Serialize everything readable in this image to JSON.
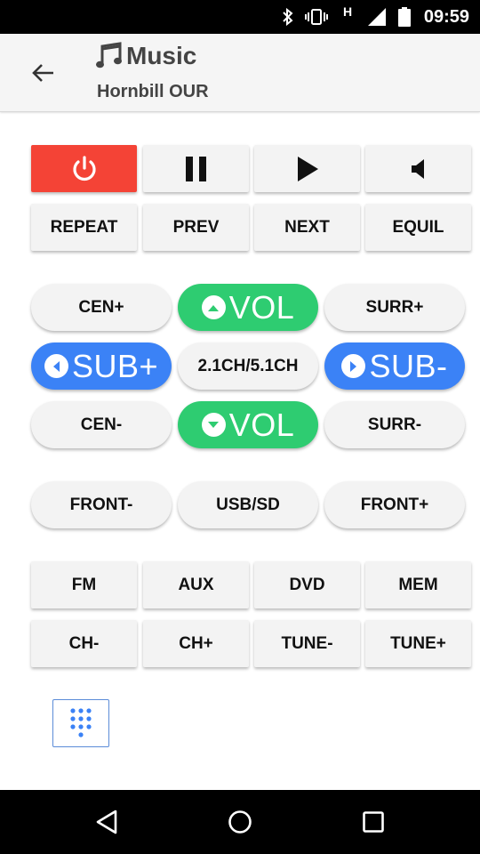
{
  "status_bar": {
    "time": "09:59",
    "icons": [
      "bluetooth-icon",
      "vibrate-icon",
      "h-network-icon",
      "signal-icon",
      "battery-icon"
    ],
    "network_label": "H"
  },
  "app_bar": {
    "title": "Music",
    "subtitle": "Hornbill OUR"
  },
  "row1": {
    "buttons": [
      "power-icon",
      "pause-icon",
      "play-icon",
      "mute-icon"
    ]
  },
  "row2": {
    "buttons": [
      "REPEAT",
      "PREV",
      "NEXT",
      "EQUIL"
    ]
  },
  "pills1": {
    "left": "CEN+",
    "center": "VOL",
    "right": "SURR+"
  },
  "pills2": {
    "left": "SUB+",
    "center": "2.1CH/5.1CH",
    "right": "SUB-"
  },
  "pills3": {
    "left": "CEN-",
    "center": "VOL",
    "right": "SURR-"
  },
  "pills4": {
    "left": "FRONT-",
    "center": "USB/SD",
    "right": "FRONT+"
  },
  "row3": {
    "buttons": [
      "FM",
      "AUX",
      "DVD",
      "MEM"
    ]
  },
  "row4": {
    "buttons": [
      "CH-",
      "CH+",
      "TUNE-",
      "TUNE+"
    ]
  },
  "colors": {
    "power": "#f44336",
    "vol": "#2ecc71",
    "sub": "#3b82f6",
    "button_bg": "#f3f3f3",
    "keypad_accent": "#3b82f6"
  }
}
